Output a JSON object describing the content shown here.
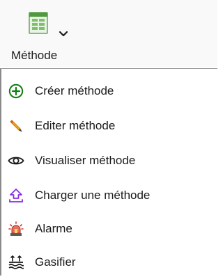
{
  "ribbon": {
    "button_label": "Méthode",
    "icon": "spreadsheet-document-icon",
    "dropdown_icon": "chevron-down-icon"
  },
  "menu": {
    "items": [
      {
        "label": "Créer méthode",
        "icon": "add-circle-icon",
        "color": "#107c10"
      },
      {
        "label": "Editer méthode",
        "icon": "pencil-icon",
        "color": "#e08a00"
      },
      {
        "label": "Visualiser méthode",
        "icon": "eye-icon",
        "color": "#1a1a1a"
      },
      {
        "label": "Charger une méthode",
        "icon": "upload-icon",
        "color": "#8a2be2"
      },
      {
        "label": "Alarme",
        "icon": "alarm-siren-icon",
        "color": "#d13438"
      },
      {
        "label": "Gasifier",
        "icon": "gasify-icon",
        "color": "#1a1a1a"
      }
    ]
  }
}
